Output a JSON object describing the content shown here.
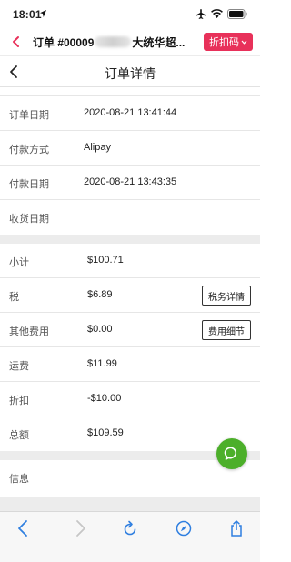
{
  "status_bar": {
    "time": "18:01",
    "icons": [
      "location-arrow-icon",
      "airplane-icon",
      "wifi-icon",
      "battery-icon"
    ]
  },
  "top_bar": {
    "title_prefix": "订单 #00009",
    "title_suffix": "大统华超...",
    "coupon_label": "折扣码",
    "accent_color": "#e8315a"
  },
  "nav": {
    "title": "订单详情"
  },
  "order_rows": [
    {
      "label": "订单日期",
      "value": "2020-08-21 13:41:44"
    },
    {
      "label": "付款方式",
      "value": "Alipay"
    },
    {
      "label": "付款日期",
      "value": "2020-08-21 13:43:35"
    },
    {
      "label": "收货日期",
      "value": ""
    }
  ],
  "summary_rows": [
    {
      "label": "小计",
      "value": "$100.71"
    },
    {
      "label": "税",
      "value": "$6.89",
      "button": "税务详情"
    },
    {
      "label": "其他费用",
      "value": "$0.00",
      "button": "费用细节"
    },
    {
      "label": "运费",
      "value": "$11.99"
    },
    {
      "label": "折扣",
      "value": "-$10.00"
    },
    {
      "label": "总额",
      "value": "$109.59"
    }
  ],
  "info": {
    "label": "信息"
  },
  "fab": {
    "icon": "chat-bubble-icon",
    "color": "#4caf2a"
  },
  "toolbar": {
    "icons": [
      "back-arrow-icon",
      "forward-arrow-icon",
      "reload-icon",
      "compass-icon",
      "share-icon"
    ],
    "tint": "#2f7fe0"
  }
}
